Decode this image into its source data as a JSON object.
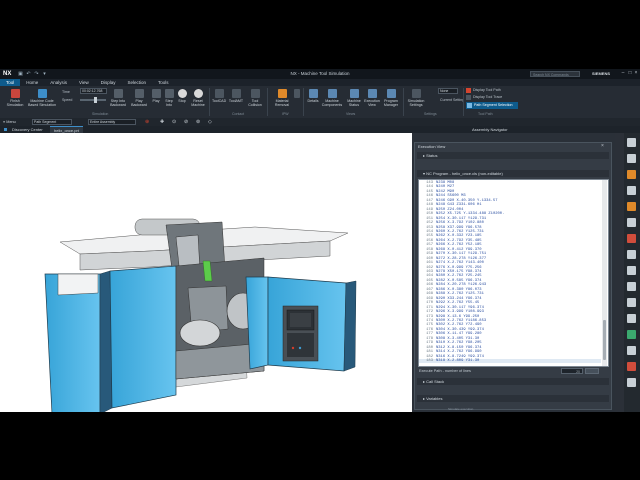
{
  "window": {
    "logo": "NX",
    "title": "NX - Machine Tool Simulation",
    "search_placeholder": "Search NX Commands",
    "brand": "SIEMENS"
  },
  "menubar": [
    "Tool",
    "Home",
    "Analysis",
    "View",
    "Display",
    "Selection",
    "Tools"
  ],
  "ribbon": {
    "finish_label": "Finish Simulation",
    "machine_code_label": "Machine Code Based Simulation",
    "time_label": "Time",
    "time_value": "00:02:12.768",
    "speed_label": "Speed",
    "step_into_label": "Step Into Backward",
    "play_backward_label": "Play Backward",
    "play_label": "Play",
    "step_into2_label": "Step Into",
    "stop_label": "Stop",
    "reset_label": "Reset Machine",
    "toolcad_label": "ToolCAD",
    "toolanmt_label": "ToolAMT",
    "tool_collision_label": "Tool Collision",
    "material_removal_label": "Material Removal",
    "ipw_label": "IPW",
    "details_label": "Details",
    "machine_components_label": "Machine Components",
    "machine_status_label": "Machine Status",
    "execution_view_label": "Execution View",
    "program_manager_label": "Program Manager",
    "simulation_settings_label": "Simulation Settings",
    "current_setting_label": "Current Setting",
    "current_setting_value": "None",
    "display_toolpath_label": "Display Tool Path",
    "display_tooltrace_label": "Display Tool Trace",
    "path_segment_selection_label": "Path Segment Selection",
    "group_simulation": "Simulation",
    "group_contact": "Contact",
    "group_ipw": "IPW",
    "group_views": "Views",
    "group_settings": "Settings",
    "group_toolpath": "Tool Path"
  },
  "toolbar2": {
    "menu_label": "Menu",
    "filter_value": "Path Segment",
    "assembly_value": "Entire Assembly"
  },
  "tabs": {
    "discovery": "Discovery Center",
    "active_tab": "helix_once.prt",
    "assembly_nav": "Assembly Navigator"
  },
  "execution": {
    "title": "Execution View",
    "status_section": "Status",
    "program_section": "NC Program - helix_once.cls (non-editable)",
    "execute_path_label": "Execute Path - number of lines",
    "execute_path_value": "20",
    "callstack_section": "Call Stack",
    "variables_section": "Variables",
    "lines": [
      {
        "num": "143",
        "text": "N238 M08"
      },
      {
        "num": "144",
        "text": "N240 M27"
      },
      {
        "num": "145",
        "text": "N242 M90"
      },
      {
        "num": "146",
        "text": "N244 S5600 M3"
      },
      {
        "num": "147",
        "text": "N246 G90 X-40.350 Y-1334.57"
      },
      {
        "num": "148",
        "text": "N248 G43 Z331.606 H1"
      },
      {
        "num": "149",
        "text": "N250 Z24.004"
      },
      {
        "num": "150",
        "text": "N252 X5.725 Y-1334.488 Z10200."
      },
      {
        "num": "151",
        "text": "N254 X-30.117 Y129.731"
      },
      {
        "num": "152",
        "text": "N256 X-3.792 Y102.880"
      },
      {
        "num": "153",
        "text": "N258 X37.999 Y96.578"
      },
      {
        "num": "154",
        "text": "N260 X-2.762 Y125.731"
      },
      {
        "num": "155",
        "text": "N262 X-0.332 Y23.185"
      },
      {
        "num": "156",
        "text": "N264 X-2.792 Y35.485"
      },
      {
        "num": "157",
        "text": "N266 X-2.762 Y52.185"
      },
      {
        "num": "158",
        "text": "N268 X-0.412 Y99.370"
      },
      {
        "num": "159",
        "text": "N270 X-30.117 Y129.751"
      },
      {
        "num": "160",
        "text": "N272 X-28.278 Y126.377"
      },
      {
        "num": "161",
        "text": "N274 X-2.762 Y143.400"
      },
      {
        "num": "162",
        "text": "N276 X-0.999 Y75.256"
      },
      {
        "num": "163",
        "text": "N278 X50.175 Y98.374"
      },
      {
        "num": "164",
        "text": "N280 X-2.762 Y25.245"
      },
      {
        "num": "165",
        "text": "N282 X-0.585 Y96.374"
      },
      {
        "num": "166",
        "text": "N284 X-20.278 Y126.943"
      },
      {
        "num": "167",
        "text": "N286 X-0.380 Y86.073"
      },
      {
        "num": "168",
        "text": "N288 X-2.762 Y125.731"
      },
      {
        "num": "169",
        "text": "N290 X33.244 Y96.374"
      },
      {
        "num": "170",
        "text": "N292 X-2.762 Y55.45"
      },
      {
        "num": "171",
        "text": "N294 X-30.117 Y96.374"
      },
      {
        "num": "172",
        "text": "N296 X-3.999 Y108.993"
      },
      {
        "num": "173",
        "text": "N298 X-13.6 Y99.250"
      },
      {
        "num": "174",
        "text": "N300 X-2.762 Y1186.853"
      },
      {
        "num": "175",
        "text": "N302 X-2.762 Y72.490"
      },
      {
        "num": "176",
        "text": "N304 X-30.439 Y99.374"
      },
      {
        "num": "177",
        "text": "N306 X-11.47 Y99.280"
      },
      {
        "num": "178",
        "text": "N308 X-3.405 Y31.30"
      },
      {
        "num": "179",
        "text": "N310 X-2.762 Y98.205"
      },
      {
        "num": "180",
        "text": "N312 X-8.150 Y96.374"
      },
      {
        "num": "181",
        "text": "N314 X-2.762 Y96.990"
      },
      {
        "num": "182",
        "text": "N316 X-8.7249 Y99.374"
      },
      {
        "num": "183",
        "text": "N318 X-2.809 Y31.30"
      }
    ],
    "current_line_index": 40
  },
  "task_note": "Simulate execution"
}
